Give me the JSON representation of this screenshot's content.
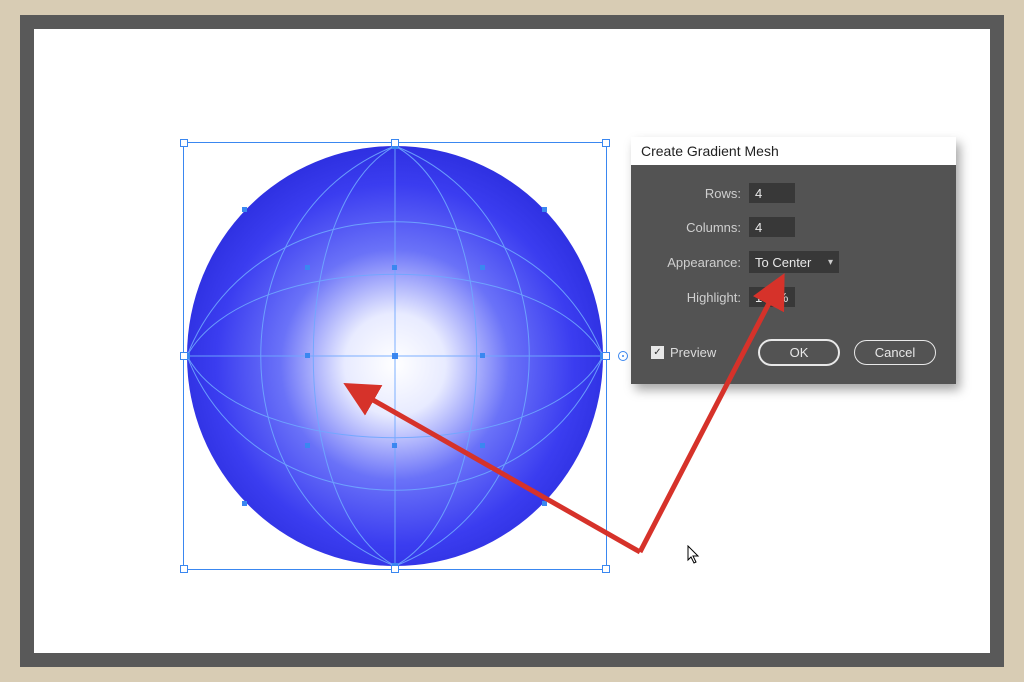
{
  "dialog": {
    "title": "Create Gradient Mesh",
    "rows_label": "Rows:",
    "rows_value": "4",
    "columns_label": "Columns:",
    "columns_value": "4",
    "appearance_label": "Appearance:",
    "appearance_value": "To Center",
    "highlight_label": "Highlight:",
    "highlight_value": "100%",
    "preview_label": "Preview",
    "preview_checked": true,
    "ok_label": "OK",
    "cancel_label": "Cancel"
  },
  "colors": {
    "sphere_edge": "#2c2ee0",
    "sphere_mid": "#4e4ff5",
    "sphere_highlight": "#ffffff",
    "selection": "#3a87f0",
    "arrow": "#d6322a"
  },
  "mesh": {
    "rows": 4,
    "columns": 4
  }
}
